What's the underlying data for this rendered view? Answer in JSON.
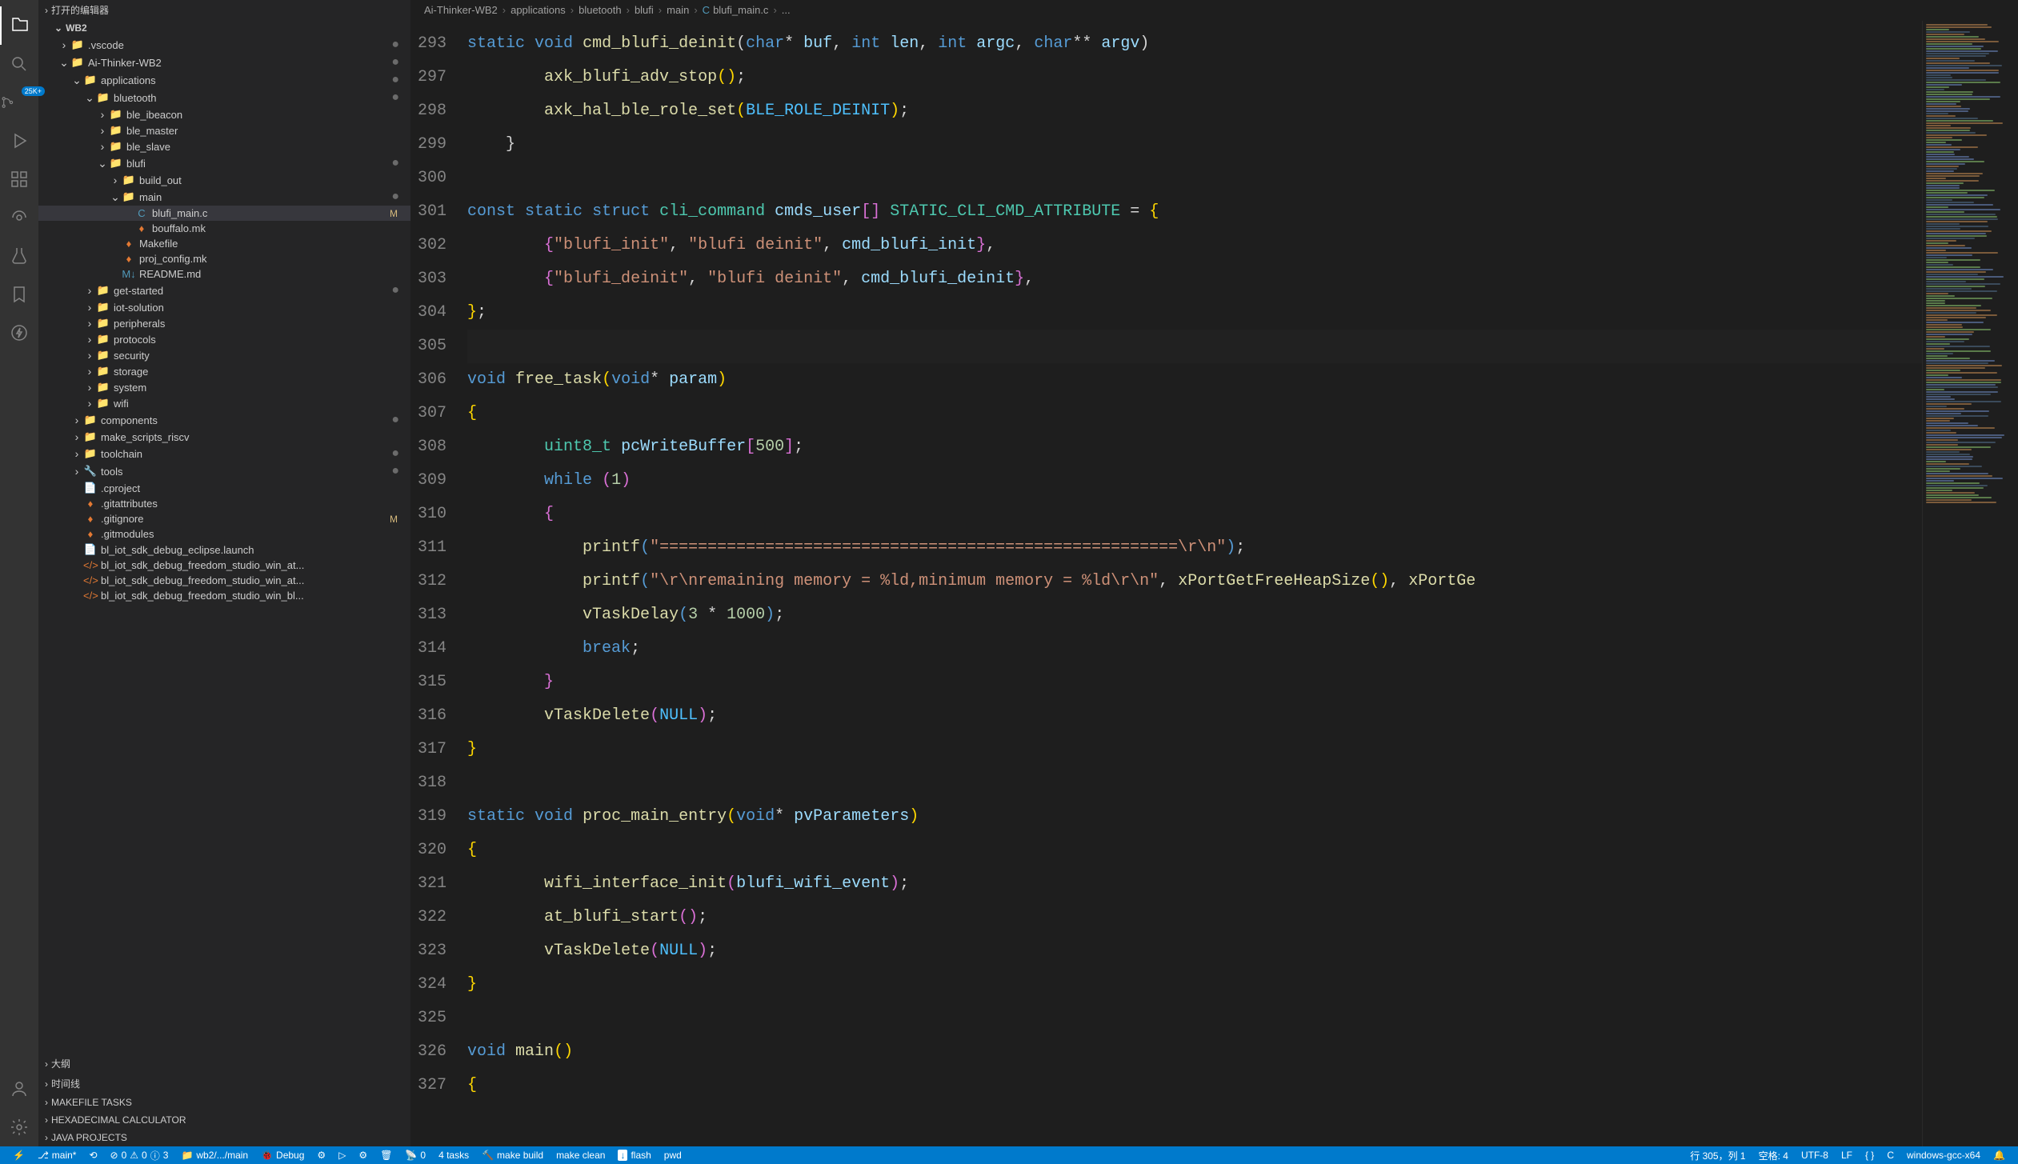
{
  "sidebar": {
    "open_editors_label": "打开的编辑器",
    "workspace_label": "WB2",
    "sections": {
      "outline": "大纲",
      "timeline": "时间线",
      "makefile_tasks": "MAKEFILE TASKS",
      "hex_calc": "HEXADECIMAL CALCULATOR",
      "java_projects": "JAVA PROJECTS"
    },
    "tree": [
      {
        "indent": 1,
        "chev": "›",
        "icon": "📁",
        "label": ".vscode",
        "dot": true
      },
      {
        "indent": 1,
        "chev": "⌄",
        "icon": "📁",
        "label": "Ai-Thinker-WB2",
        "dot": true
      },
      {
        "indent": 2,
        "chev": "⌄",
        "icon": "📁",
        "label": "applications",
        "dot": true
      },
      {
        "indent": 3,
        "chev": "⌄",
        "icon": "📁",
        "label": "bluetooth",
        "dot": true
      },
      {
        "indent": 4,
        "chev": "›",
        "icon": "📁",
        "label": "ble_ibeacon"
      },
      {
        "indent": 4,
        "chev": "›",
        "icon": "📁",
        "label": "ble_master"
      },
      {
        "indent": 4,
        "chev": "›",
        "icon": "📁",
        "label": "ble_slave"
      },
      {
        "indent": 4,
        "chev": "⌄",
        "icon": "📁",
        "label": "blufi",
        "dot": true
      },
      {
        "indent": 5,
        "chev": "›",
        "icon": "📁",
        "label": "build_out"
      },
      {
        "indent": 5,
        "chev": "⌄",
        "icon": "📁",
        "label": "main",
        "dot": true
      },
      {
        "indent": 6,
        "chev": "",
        "icon": "C",
        "iconColor": "#519aba",
        "label": "blufi_main.c",
        "mod": "M",
        "active": true
      },
      {
        "indent": 6,
        "chev": "",
        "icon": "♦",
        "iconColor": "#e37933",
        "label": "bouffalo.mk"
      },
      {
        "indent": 5,
        "chev": "",
        "icon": "♦",
        "iconColor": "#e37933",
        "label": "Makefile"
      },
      {
        "indent": 5,
        "chev": "",
        "icon": "♦",
        "iconColor": "#e37933",
        "label": "proj_config.mk"
      },
      {
        "indent": 5,
        "chev": "",
        "icon": "M↓",
        "iconColor": "#519aba",
        "label": "README.md"
      },
      {
        "indent": 3,
        "chev": "›",
        "icon": "📁",
        "label": "get-started",
        "dot": true
      },
      {
        "indent": 3,
        "chev": "›",
        "icon": "📁",
        "label": "iot-solution"
      },
      {
        "indent": 3,
        "chev": "›",
        "icon": "📁",
        "label": "peripherals"
      },
      {
        "indent": 3,
        "chev": "›",
        "icon": "📁",
        "label": "protocols"
      },
      {
        "indent": 3,
        "chev": "›",
        "icon": "📁",
        "label": "security"
      },
      {
        "indent": 3,
        "chev": "›",
        "icon": "📁",
        "label": "storage"
      },
      {
        "indent": 3,
        "chev": "›",
        "icon": "📁",
        "label": "system"
      },
      {
        "indent": 3,
        "chev": "›",
        "icon": "📁",
        "label": "wifi"
      },
      {
        "indent": 2,
        "chev": "›",
        "icon": "📁",
        "label": "components",
        "dot": true
      },
      {
        "indent": 2,
        "chev": "›",
        "icon": "📁",
        "label": "make_scripts_riscv"
      },
      {
        "indent": 2,
        "chev": "›",
        "icon": "📁",
        "label": "toolchain",
        "dot": true
      },
      {
        "indent": 2,
        "chev": "›",
        "icon": "🔧",
        "iconColor": "#dcb67a",
        "label": "tools",
        "dot": true
      },
      {
        "indent": 2,
        "chev": "",
        "icon": "📄",
        "iconColor": "#cccccc",
        "label": ".cproject"
      },
      {
        "indent": 2,
        "chev": "",
        "icon": "♦",
        "iconColor": "#e37933",
        "label": ".gitattributes"
      },
      {
        "indent": 2,
        "chev": "",
        "icon": "♦",
        "iconColor": "#e37933",
        "label": ".gitignore",
        "mod": "M"
      },
      {
        "indent": 2,
        "chev": "",
        "icon": "♦",
        "iconColor": "#e37933",
        "label": ".gitmodules"
      },
      {
        "indent": 2,
        "chev": "",
        "icon": "📄",
        "iconColor": "#cccccc",
        "label": "bl_iot_sdk_debug_eclipse.launch"
      },
      {
        "indent": 2,
        "chev": "",
        "icon": "</>",
        "iconColor": "#e37933",
        "label": "bl_iot_sdk_debug_freedom_studio_win_at..."
      },
      {
        "indent": 2,
        "chev": "",
        "icon": "</>",
        "iconColor": "#e37933",
        "label": "bl_iot_sdk_debug_freedom_studio_win_at..."
      },
      {
        "indent": 2,
        "chev": "",
        "icon": "</>",
        "iconColor": "#e37933",
        "label": "bl_iot_sdk_debug_freedom_studio_win_bl..."
      }
    ]
  },
  "breadcrumbs": [
    "Ai-Thinker-WB2",
    "applications",
    "bluetooth",
    "blufi",
    "main",
    "blufi_main.c",
    "..."
  ],
  "breadcrumb_file_icon": "C",
  "code_lines": [
    {
      "n": 293,
      "tokens": [
        [
          "kw",
          "static"
        ],
        [
          "sp",
          " "
        ],
        [
          "kw",
          "void"
        ],
        [
          "sp",
          " "
        ],
        [
          "fn",
          "cmd_blufi_deinit"
        ],
        [
          "punc",
          "("
        ],
        [
          "kw",
          "char"
        ],
        [
          "op",
          "*"
        ],
        [
          "sp",
          " "
        ],
        [
          "var",
          "buf"
        ],
        [
          "punc",
          ", "
        ],
        [
          "kw",
          "int"
        ],
        [
          "sp",
          " "
        ],
        [
          "var",
          "len"
        ],
        [
          "punc",
          ", "
        ],
        [
          "kw",
          "int"
        ],
        [
          "sp",
          " "
        ],
        [
          "var",
          "argc"
        ],
        [
          "punc",
          ", "
        ],
        [
          "kw",
          "char"
        ],
        [
          "op",
          "**"
        ],
        [
          "sp",
          " "
        ],
        [
          "var",
          "argv"
        ],
        [
          "punc",
          ")"
        ]
      ]
    },
    {
      "n": 297,
      "tokens": [
        [
          "sp",
          "        "
        ],
        [
          "fn",
          "axk_blufi_adv_stop"
        ],
        [
          "br",
          "("
        ],
        [
          "br",
          ")"
        ],
        [
          "punc",
          ";"
        ]
      ]
    },
    {
      "n": 298,
      "tokens": [
        [
          "sp",
          "        "
        ],
        [
          "fn",
          "axk_hal_ble_role_set"
        ],
        [
          "br",
          "("
        ],
        [
          "const",
          "BLE_ROLE_DEINIT"
        ],
        [
          "br",
          ")"
        ],
        [
          "punc",
          ";"
        ]
      ]
    },
    {
      "n": 299,
      "tokens": [
        [
          "sp",
          "    "
        ],
        [
          "punc",
          "}"
        ]
      ]
    },
    {
      "n": 300,
      "tokens": []
    },
    {
      "n": 301,
      "tokens": [
        [
          "kw",
          "const"
        ],
        [
          "sp",
          " "
        ],
        [
          "kw",
          "static"
        ],
        [
          "sp",
          " "
        ],
        [
          "kw",
          "struct"
        ],
        [
          "sp",
          " "
        ],
        [
          "struct",
          "cli_command"
        ],
        [
          "sp",
          " "
        ],
        [
          "var",
          "cmds_user"
        ],
        [
          "brp",
          "["
        ],
        [
          "brp",
          "]"
        ],
        [
          "sp",
          " "
        ],
        [
          "macro",
          "STATIC_CLI_CMD_ATTRIBUTE"
        ],
        [
          "sp",
          " "
        ],
        [
          "op",
          "="
        ],
        [
          "sp",
          " "
        ],
        [
          "br",
          "{"
        ]
      ]
    },
    {
      "n": 302,
      "tokens": [
        [
          "sp",
          "        "
        ],
        [
          "brp",
          "{"
        ],
        [
          "str",
          "\"blufi_init\""
        ],
        [
          "punc",
          ", "
        ],
        [
          "str",
          "\"blufi deinit\""
        ],
        [
          "punc",
          ", "
        ],
        [
          "var",
          "cmd_blufi_init"
        ],
        [
          "brp",
          "}"
        ],
        [
          "punc",
          ","
        ]
      ]
    },
    {
      "n": 303,
      "tokens": [
        [
          "sp",
          "        "
        ],
        [
          "brp",
          "{"
        ],
        [
          "str",
          "\"blufi_deinit\""
        ],
        [
          "punc",
          ", "
        ],
        [
          "str",
          "\"blufi deinit\""
        ],
        [
          "punc",
          ", "
        ],
        [
          "var",
          "cmd_blufi_deinit"
        ],
        [
          "brp",
          "}"
        ],
        [
          "punc",
          ","
        ]
      ]
    },
    {
      "n": 304,
      "tokens": [
        [
          "br",
          "}"
        ],
        [
          "punc",
          ";"
        ]
      ]
    },
    {
      "n": 305,
      "tokens": [],
      "cursor": true
    },
    {
      "n": 306,
      "tokens": [
        [
          "kw",
          "void"
        ],
        [
          "sp",
          " "
        ],
        [
          "fn",
          "free_task"
        ],
        [
          "br",
          "("
        ],
        [
          "kw",
          "void"
        ],
        [
          "op",
          "*"
        ],
        [
          "sp",
          " "
        ],
        [
          "var",
          "param"
        ],
        [
          "br",
          ")"
        ]
      ],
      "marker": true
    },
    {
      "n": 307,
      "tokens": [
        [
          "br",
          "{"
        ]
      ]
    },
    {
      "n": 308,
      "tokens": [
        [
          "sp",
          "        "
        ],
        [
          "struct",
          "uint8_t"
        ],
        [
          "sp",
          " "
        ],
        [
          "var",
          "pcWriteBuffer"
        ],
        [
          "brp",
          "["
        ],
        [
          "num",
          "500"
        ],
        [
          "brp",
          "]"
        ],
        [
          "punc",
          ";"
        ]
      ]
    },
    {
      "n": 309,
      "tokens": [
        [
          "sp",
          "        "
        ],
        [
          "kw",
          "while"
        ],
        [
          "sp",
          " "
        ],
        [
          "brp",
          "("
        ],
        [
          "num",
          "1"
        ],
        [
          "brp",
          ")"
        ]
      ]
    },
    {
      "n": 310,
      "tokens": [
        [
          "sp",
          "        "
        ],
        [
          "brp",
          "{"
        ]
      ]
    },
    {
      "n": 311,
      "tokens": [
        [
          "sp",
          "            "
        ],
        [
          "fn",
          "printf"
        ],
        [
          "brb",
          "("
        ],
        [
          "str",
          "\"======================================================\\r\\n\""
        ],
        [
          "brb",
          ")"
        ],
        [
          "punc",
          ";"
        ]
      ]
    },
    {
      "n": 312,
      "tokens": [
        [
          "sp",
          "            "
        ],
        [
          "fn",
          "printf"
        ],
        [
          "brb",
          "("
        ],
        [
          "str",
          "\"\\r\\nremaining memory = %ld,minimum memory = %ld\\r\\n\""
        ],
        [
          "punc",
          ", "
        ],
        [
          "fn",
          "xPortGetFreeHeapSize"
        ],
        [
          "br",
          "("
        ],
        [
          "br",
          ")"
        ],
        [
          "punc",
          ", "
        ],
        [
          "fn",
          "xPortGe"
        ]
      ]
    },
    {
      "n": 313,
      "tokens": [
        [
          "sp",
          "            "
        ],
        [
          "fn",
          "vTaskDelay"
        ],
        [
          "brb",
          "("
        ],
        [
          "num",
          "3"
        ],
        [
          "sp",
          " "
        ],
        [
          "op",
          "*"
        ],
        [
          "sp",
          " "
        ],
        [
          "num",
          "1000"
        ],
        [
          "brb",
          ")"
        ],
        [
          "punc",
          ";"
        ]
      ]
    },
    {
      "n": 314,
      "tokens": [
        [
          "sp",
          "            "
        ],
        [
          "kw",
          "break"
        ],
        [
          "punc",
          ";"
        ]
      ],
      "marker": true
    },
    {
      "n": 315,
      "tokens": [
        [
          "sp",
          "        "
        ],
        [
          "brp",
          "}"
        ]
      ]
    },
    {
      "n": 316,
      "tokens": [
        [
          "sp",
          "        "
        ],
        [
          "fn",
          "vTaskDelete"
        ],
        [
          "brp",
          "("
        ],
        [
          "const",
          "NULL"
        ],
        [
          "brp",
          ")"
        ],
        [
          "punc",
          ";"
        ]
      ]
    },
    {
      "n": 317,
      "tokens": [
        [
          "br",
          "}"
        ]
      ]
    },
    {
      "n": 318,
      "tokens": []
    },
    {
      "n": 319,
      "tokens": [
        [
          "kw",
          "static"
        ],
        [
          "sp",
          " "
        ],
        [
          "kw",
          "void"
        ],
        [
          "sp",
          " "
        ],
        [
          "fn",
          "proc_main_entry"
        ],
        [
          "br",
          "("
        ],
        [
          "kw",
          "void"
        ],
        [
          "op",
          "*"
        ],
        [
          "sp",
          " "
        ],
        [
          "var",
          "pvParameters"
        ],
        [
          "br",
          ")"
        ]
      ],
      "marker": true
    },
    {
      "n": 320,
      "tokens": [
        [
          "br",
          "{"
        ]
      ]
    },
    {
      "n": 321,
      "tokens": [
        [
          "sp",
          "        "
        ],
        [
          "fn",
          "wifi_interface_init"
        ],
        [
          "brp",
          "("
        ],
        [
          "var",
          "blufi_wifi_event"
        ],
        [
          "brp",
          ")"
        ],
        [
          "punc",
          ";"
        ]
      ]
    },
    {
      "n": 322,
      "tokens": [
        [
          "sp",
          "        "
        ],
        [
          "fn",
          "at_blufi_start"
        ],
        [
          "brp",
          "("
        ],
        [
          "brp",
          ")"
        ],
        [
          "punc",
          ";"
        ]
      ]
    },
    {
      "n": 323,
      "tokens": [
        [
          "sp",
          "        "
        ],
        [
          "fn",
          "vTaskDelete"
        ],
        [
          "brp",
          "("
        ],
        [
          "const",
          "NULL"
        ],
        [
          "brp",
          ")"
        ],
        [
          "punc",
          ";"
        ]
      ]
    },
    {
      "n": 324,
      "tokens": [
        [
          "br",
          "}"
        ]
      ]
    },
    {
      "n": 325,
      "tokens": []
    },
    {
      "n": 326,
      "tokens": [
        [
          "kw",
          "void"
        ],
        [
          "sp",
          " "
        ],
        [
          "fn",
          "main"
        ],
        [
          "br",
          "("
        ],
        [
          "br",
          ")"
        ]
      ]
    },
    {
      "n": 327,
      "tokens": [
        [
          "br",
          "{"
        ]
      ]
    }
  ],
  "status": {
    "remote": "",
    "branch": "main*",
    "sync": "",
    "errors": "0",
    "warnings": "0",
    "info": "3",
    "path": "wb2/.../main",
    "debug": "Debug",
    "tasks": "4 tasks",
    "make_build": "make build",
    "make_clean": "make clean",
    "flash": "flash",
    "pwd": "pwd",
    "cursor": "行 305，列 1",
    "spaces": "空格: 4",
    "encoding": "UTF-8",
    "eol": "LF",
    "lang_bracket": "{ }",
    "lang": "C",
    "compiler": "windows-gcc-x64"
  },
  "activity_badge": "25K+"
}
